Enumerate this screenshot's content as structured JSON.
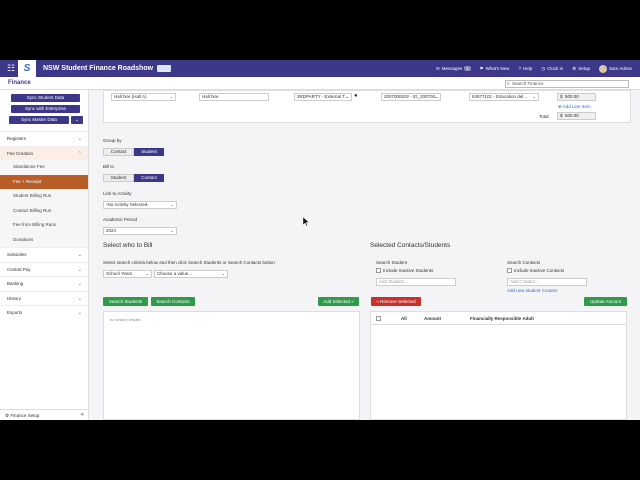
{
  "topbar": {
    "app_title": "NSW Student Finance Roadshow",
    "messages_label": "Messages",
    "messages_count": "3",
    "whats_new": "What's New",
    "help": "Help",
    "clock_in": "Clock in",
    "setup": "Setup",
    "user_name": "Sam Admin"
  },
  "subbar": {
    "title": "Finance",
    "search_placeholder": "Search Finance"
  },
  "sidebar": {
    "sync_student": "Sync Student Data",
    "sync_enterprise": "Sync with Enterprise",
    "sync_master": "Sync Master Data",
    "registers": "Registers",
    "fee_creation": "Fee Creation",
    "standalone_fee": "Standalone Fee",
    "fee_receipt": "Fee + Receipt",
    "student_billing_run": "Student Billing Run",
    "contact_billing_run": "Contact Billing Run",
    "fee_from_billing_runs": "Fee from Billing Runs",
    "donations": "Donations",
    "subsidies": "Subsidies",
    "central_pay": "Central Pay",
    "banking": "Banking",
    "history": "History",
    "exports": "Exports",
    "finance_setup": "Finance Setup"
  },
  "fee_line": {
    "item": "Hall hire (Hall A)",
    "description": "Hall hire",
    "third_party": "3RDPARTY - External T...",
    "code": "2007000002 - ID_200700...",
    "account": "63977101 - Education del...",
    "amount_currency": "$",
    "amount": "500.00",
    "add_line_item": "Add Line Item",
    "total_label": "Total",
    "total_currency": "$",
    "total": "500.00"
  },
  "form": {
    "group_by_label": "Group by",
    "group_contact": "Contact",
    "group_student": "Student",
    "bill_to_label": "Bill to",
    "bill_student": "Student",
    "bill_contact": "Contact",
    "link_activity_label": "Link to Activity",
    "link_activity_value": "-No Activity Selected-",
    "academic_period_label": "Academic Period",
    "academic_period_value": "2024"
  },
  "select_who": {
    "heading": "Select who to Bill",
    "instructions": "Select search criteria below and then click Search Students or Search Contacts button",
    "filter_value": "School Years",
    "choose_value": "Choose a value...",
    "search_students": "Search Students",
    "search_contacts": "Search Contacts",
    "add_selected": "Add Selected »",
    "no_results": "no search results"
  },
  "selected_contacts": {
    "heading": "Selected Contacts/Students",
    "search_student_label": "Search Student",
    "include_inactive_students": "Include Inactive Students",
    "add_student_placeholder": "Add Student...",
    "search_contacts_label": "Search Contacts",
    "include_inactive_contacts": "Include Inactive Contacts",
    "add_contact_placeholder": "Add Contact...",
    "add_new_contact": "Add new student Contact",
    "remove_selected": "« Remove Selected",
    "update_amount": "Update Amount",
    "col_all": "All",
    "col_amount": "Amount",
    "col_responsible": "Financially Responsible Adult"
  },
  "colors": {
    "brand": "#3d3789",
    "active_nav": "#b85c28",
    "green": "#2e9b4a",
    "red": "#c8302c",
    "arrow": "#e02020"
  }
}
